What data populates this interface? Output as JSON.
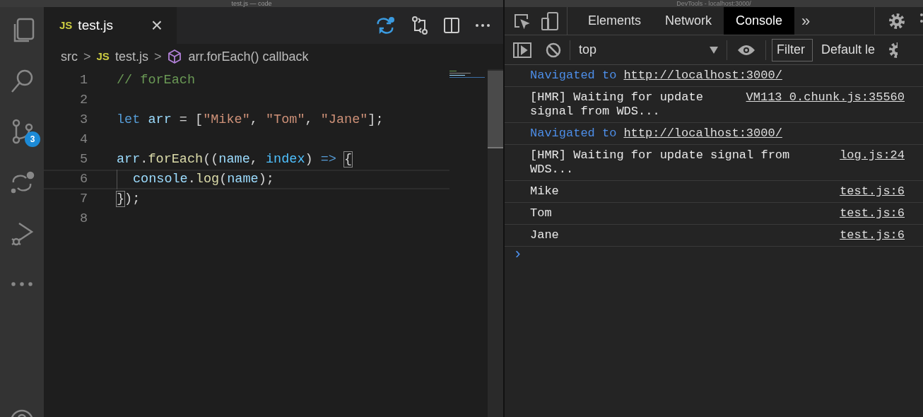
{
  "editor": {
    "window_title": "test.js — code",
    "activity_bar": [
      {
        "kind": "files",
        "selected": false
      },
      {
        "kind": "search",
        "selected": false
      },
      {
        "kind": "scm",
        "selected": false,
        "badge": "3"
      },
      {
        "kind": "diff",
        "selected": false
      },
      {
        "kind": "debug",
        "selected": false
      },
      {
        "kind": "more",
        "selected": false
      }
    ],
    "tabs": [
      {
        "badge": "JS",
        "label": "test.js",
        "close": "×",
        "selected": true
      }
    ],
    "breadcrumbs": [
      {
        "kind": "folder",
        "label": "src"
      },
      {
        "kind": "file",
        "badge": "JS",
        "label": "test.js"
      },
      {
        "kind": "symbol",
        "label": "arr.forEach() callback"
      }
    ],
    "breadcrumb_separator": ">",
    "lines": [
      {
        "number": "1",
        "tokens": [
          {
            "kind": "comment",
            "text": "// forEach"
          }
        ]
      },
      {
        "number": "2"
      },
      {
        "number": "3",
        "tokens": [
          {
            "kind": "keyword",
            "text": "let "
          },
          {
            "kind": "variable",
            "text": "arr"
          },
          {
            "kind": "plain",
            "text": " = ["
          },
          {
            "kind": "string",
            "text": "\"Mike\""
          },
          {
            "kind": "plain",
            "text": ", "
          },
          {
            "kind": "string",
            "text": "\"Tom\""
          },
          {
            "kind": "plain",
            "text": ", "
          },
          {
            "kind": "string",
            "text": "\"Jane\""
          },
          {
            "kind": "plain",
            "text": "];"
          }
        ]
      },
      {
        "number": "4"
      },
      {
        "number": "5",
        "tokens": [
          {
            "kind": "variable",
            "text": "arr"
          },
          {
            "kind": "plain",
            "text": "."
          },
          {
            "kind": "function",
            "text": "forEach"
          },
          {
            "kind": "plain",
            "text": "(("
          },
          {
            "kind": "variable",
            "text": "name"
          },
          {
            "kind": "plain",
            "text": ", "
          },
          {
            "kind": "param",
            "text": "index"
          },
          {
            "kind": "plain",
            "text": ") "
          },
          {
            "kind": "keyword",
            "text": "=> "
          },
          {
            "kind": "bracket",
            "text": "{"
          }
        ]
      },
      {
        "number": "6",
        "indented": true,
        "tokens": [
          {
            "kind": "variable",
            "text": "console"
          },
          {
            "kind": "plain",
            "text": "."
          },
          {
            "kind": "function",
            "text": "log"
          },
          {
            "kind": "plain",
            "text": "("
          },
          {
            "kind": "variable",
            "text": "name"
          },
          {
            "kind": "plain",
            "text": ");"
          }
        ],
        "current": true
      },
      {
        "number": "7",
        "tokens": [
          {
            "kind": "bracket",
            "text": "}"
          },
          {
            "kind": "plain",
            "text": ");"
          }
        ]
      },
      {
        "number": "8"
      }
    ]
  },
  "devtools": {
    "window_title": "DevTools - localhost:3000/",
    "tabs": [
      {
        "label": "Elements",
        "selected": false
      },
      {
        "label": "Network",
        "selected": false
      },
      {
        "label": "Console",
        "selected": true
      }
    ],
    "more_tabs": "»",
    "context": "top",
    "filter": {
      "placeholder": "Filter"
    },
    "levels": "Default le",
    "messages": [
      {
        "kind": "nav",
        "text": "Navigated to",
        "link": "http://localhost:3000/"
      },
      {
        "kind": "log",
        "text": "[HMR] Waiting for update signal from WDS...",
        "source": "VM113 0.chunk.js:35560"
      },
      {
        "kind": "nav",
        "text": "Navigated to",
        "link": "http://localhost:3000/"
      },
      {
        "kind": "log",
        "text": "[HMR] Waiting for update signal from WDS...",
        "source": "log.js:24"
      },
      {
        "kind": "log",
        "text": "Mike",
        "source": "test.js:6"
      },
      {
        "kind": "log",
        "text": "Tom",
        "source": "test.js:6"
      },
      {
        "kind": "log",
        "text": "Jane",
        "source": "test.js:6"
      }
    ],
    "prompt": "›"
  }
}
